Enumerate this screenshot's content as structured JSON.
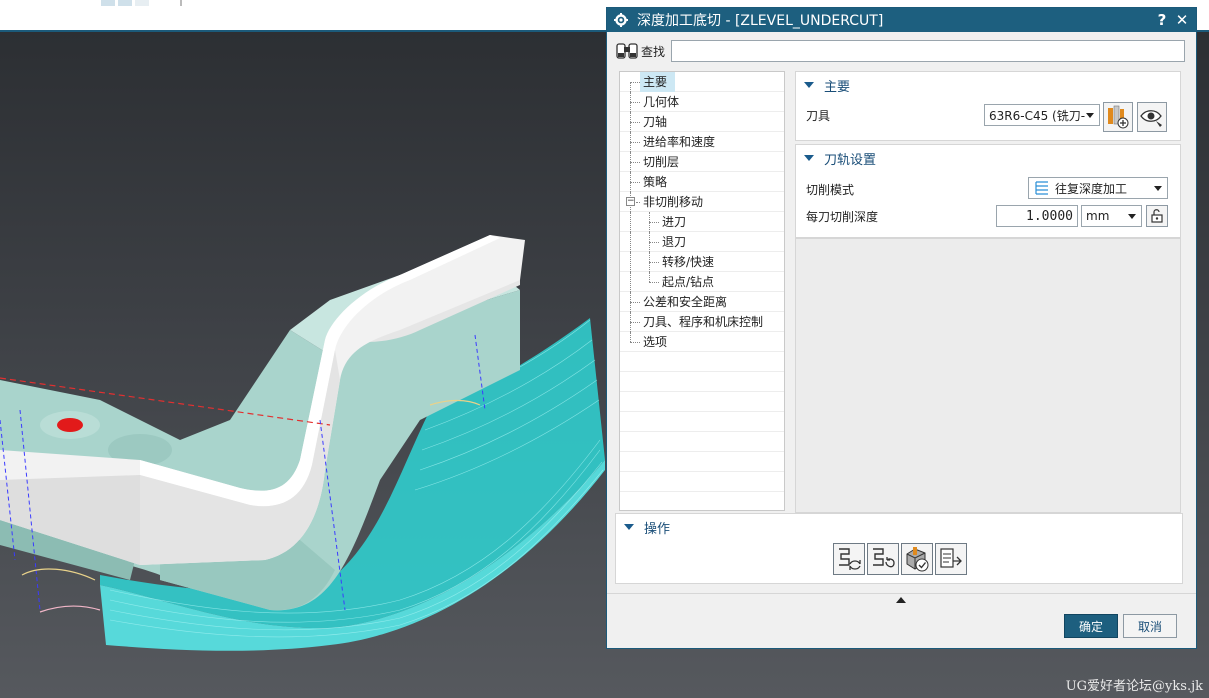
{
  "dialog": {
    "title": "深度加工底切 - [ZLEVEL_UNDERCUT]",
    "help_label": "?",
    "close_label": "✕",
    "find_label": "查找",
    "find_value": ""
  },
  "tree": {
    "items": [
      {
        "label": "主要",
        "level": 0,
        "selected": true
      },
      {
        "label": "几何体",
        "level": 0
      },
      {
        "label": "刀轴",
        "level": 0
      },
      {
        "label": "进给率和速度",
        "level": 0
      },
      {
        "label": "切削层",
        "level": 0
      },
      {
        "label": "策略",
        "level": 0
      },
      {
        "label": "非切削移动",
        "level": 0,
        "expandable": true
      },
      {
        "label": "进刀",
        "level": 1
      },
      {
        "label": "退刀",
        "level": 1
      },
      {
        "label": "转移/快速",
        "level": 1
      },
      {
        "label": "起点/钻点",
        "level": 1
      },
      {
        "label": "公差和安全距离",
        "level": 0
      },
      {
        "label": "刀具、程序和机床控制",
        "level": 0
      },
      {
        "label": "选项",
        "level": 0
      }
    ]
  },
  "main_section": {
    "title": "主要",
    "tool_label": "刀具",
    "tool_value": "63R6-C45 (铣刀-"
  },
  "path_section": {
    "title": "刀轨设置",
    "cut_mode_label": "切削模式",
    "cut_mode_value": "往复深度加工",
    "depth_label": "每刀切削深度",
    "depth_value": "1.0000",
    "depth_unit": "mm"
  },
  "actions_section": {
    "title": "操作"
  },
  "buttons": {
    "ok": "确定",
    "cancel": "取消"
  },
  "watermark": "UG爱好者论坛@yks.jk",
  "colors": {
    "titlebar": "#1d5f7f",
    "toolpath": "#3fe0e0",
    "model": "#a9d4cc"
  }
}
